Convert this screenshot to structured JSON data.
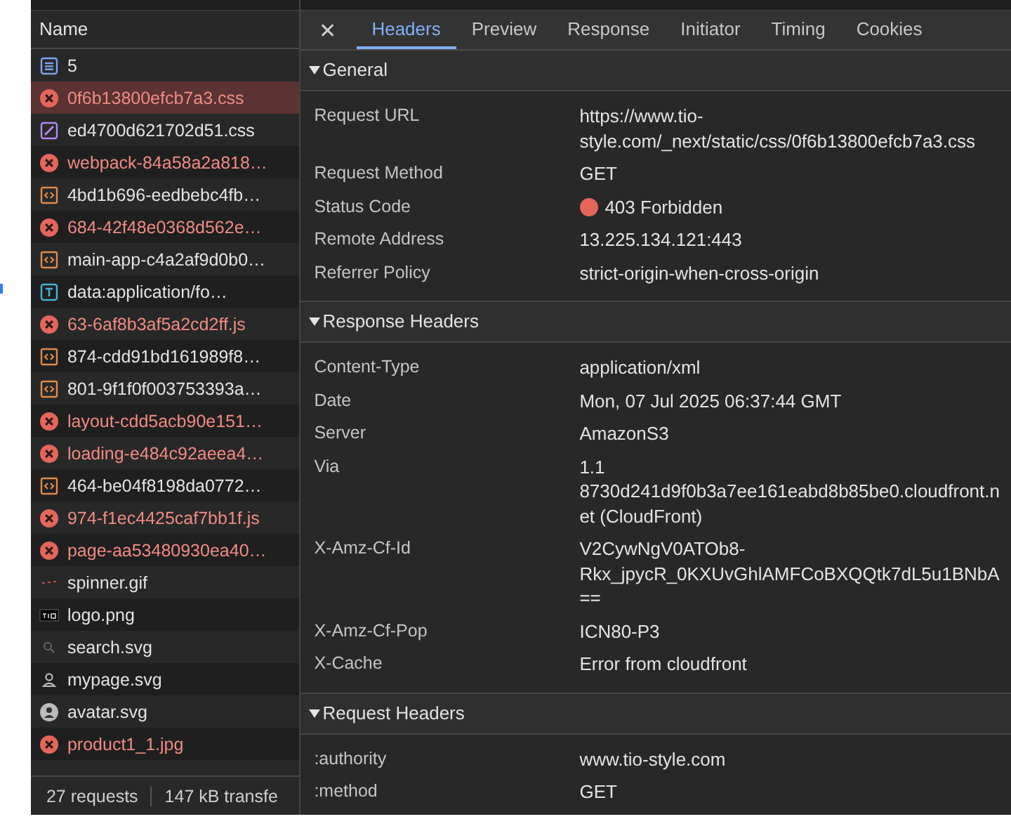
{
  "requests": {
    "column": "Name",
    "rows": [
      {
        "name": "5",
        "kind": "document",
        "failed": false,
        "selected": false
      },
      {
        "name": "0f6b13800efcb7a3.css",
        "kind": "error",
        "failed": true,
        "selected": true
      },
      {
        "name": "ed4700d621702d51.css",
        "kind": "stylesheet",
        "failed": false,
        "selected": false
      },
      {
        "name": "webpack-84a58a2a818…",
        "kind": "error",
        "failed": true,
        "selected": false
      },
      {
        "name": "4bd1b696-eedbebc4fb…",
        "kind": "script",
        "failed": false,
        "selected": false
      },
      {
        "name": "684-42f48e0368d562e…",
        "kind": "error",
        "failed": true,
        "selected": false
      },
      {
        "name": "main-app-c4a2af9d0b0…",
        "kind": "script",
        "failed": false,
        "selected": false
      },
      {
        "name": "data:application/fo…",
        "kind": "font",
        "failed": false,
        "selected": false
      },
      {
        "name": "63-6af8b3af5a2cd2ff.js",
        "kind": "error",
        "failed": true,
        "selected": false
      },
      {
        "name": "874-cdd91bd161989f8…",
        "kind": "script",
        "failed": false,
        "selected": false
      },
      {
        "name": "801-9f1f0f003753393a…",
        "kind": "script",
        "failed": false,
        "selected": false
      },
      {
        "name": "layout-cdd5acb90e151…",
        "kind": "error",
        "failed": true,
        "selected": false
      },
      {
        "name": "loading-e484c92aeea4…",
        "kind": "error",
        "failed": true,
        "selected": false
      },
      {
        "name": "464-be04f8198da0772…",
        "kind": "script",
        "failed": false,
        "selected": false
      },
      {
        "name": "974-f1ec4425caf7bb1f.js",
        "kind": "error",
        "failed": true,
        "selected": false
      },
      {
        "name": "page-aa53480930ea40…",
        "kind": "error",
        "failed": true,
        "selected": false
      },
      {
        "name": "spinner.gif",
        "kind": "gif",
        "failed": false,
        "selected": false
      },
      {
        "name": "logo.png",
        "kind": "logo",
        "failed": false,
        "selected": false
      },
      {
        "name": "search.svg",
        "kind": "search",
        "failed": false,
        "selected": false
      },
      {
        "name": "mypage.svg",
        "kind": "person",
        "failed": false,
        "selected": false
      },
      {
        "name": "avatar.svg",
        "kind": "avatar",
        "failed": false,
        "selected": false
      },
      {
        "name": "product1_1.jpg",
        "kind": "error",
        "failed": true,
        "selected": false
      }
    ],
    "status_bar": [
      "27 requests",
      "147 kB transfe"
    ]
  },
  "detail": {
    "close": "✕",
    "tabs": [
      {
        "label": "Headers",
        "selected": true
      },
      {
        "label": "Preview",
        "selected": false
      },
      {
        "label": "Response",
        "selected": false
      },
      {
        "label": "Initiator",
        "selected": false
      },
      {
        "label": "Timing",
        "selected": false
      },
      {
        "label": "Cookies",
        "selected": false
      }
    ],
    "sections": [
      {
        "title": "General",
        "expanded": true,
        "rows": [
          {
            "name": "Request URL",
            "value": "https://www.tio-style.com/_next/static/css/0f6b13800efcb7a3.css"
          },
          {
            "name": "Request Method",
            "value": "GET"
          },
          {
            "name": "Status Code",
            "value": "403 Forbidden",
            "color": "#e5665b"
          },
          {
            "name": "Remote Address",
            "value": "13.225.134.121:443"
          },
          {
            "name": "Referrer Policy",
            "value": "strict-origin-when-cross-origin"
          }
        ]
      },
      {
        "title": "Response Headers",
        "expanded": true,
        "rows": [
          {
            "name": "Content-Type",
            "value": "application/xml"
          },
          {
            "name": "Date",
            "value": "Mon, 07 Jul 2025 06:37:44 GMT"
          },
          {
            "name": "Server",
            "value": "AmazonS3"
          },
          {
            "name": "Via",
            "value": "1.1 8730d241d9f0b3a7ee161eabd8b85be0.cloudfront.net (CloudFront)"
          },
          {
            "name": "X-Amz-Cf-Id",
            "value": "V2CywNgV0ATOb8-Rkx_jpycR_0KXUvGhlAMFCoBXQQtk7dL5u1BNbA=="
          },
          {
            "name": "X-Amz-Cf-Pop",
            "value": "ICN80-P3"
          },
          {
            "name": "X-Cache",
            "value": "Error from cloudfront"
          }
        ]
      },
      {
        "title": "Request Headers",
        "expanded": true,
        "rows": [
          {
            "name": ":authority",
            "value": "www.tio-style.com"
          },
          {
            "name": ":method",
            "value": "GET"
          }
        ]
      }
    ]
  }
}
